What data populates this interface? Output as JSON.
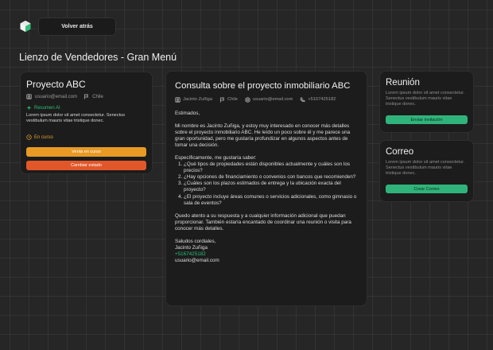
{
  "header": {
    "back_label": "Volver atrás",
    "page_title": "Lienzo de Vendedores - Gran Menú"
  },
  "project": {
    "title": "Proyecto ABC",
    "email": "usuario@email.com",
    "country": "Chile",
    "ai_label": "Resumen AI",
    "ai_summary": "Lorem ipsum dolor sit amet consectetur. Senectus vestibulum mauris vitae tristique donec.",
    "status": "En curso",
    "primary_button": "Venta en curso",
    "secondary_button": "Cambiar estado"
  },
  "email": {
    "subject": "Consulta sobre el proyecto inmobiliario ABC",
    "sender_name": "Jacinto Zuñiga",
    "country": "Chile",
    "sender_email": "usuario@email.com",
    "phone": "+5167425182",
    "greeting": "Estimados,",
    "intro": "Mi nombre es Jacinto Zuñiga, y estoy muy interesado en conocer más detalles sobre el proyecto inmobiliario ABC. He leído un poco sobre él y me parece una gran oportunidad, pero me gustaría profundizar en algunos aspectos antes de tomar una decisión.",
    "questions_intro": "Específicamente, me gustaría saber:",
    "questions": [
      "¿Qué tipos de propiedades están disponibles actualmente y cuáles son los precios?",
      "¿Hay opciones de financiamiento o convenios con bancos que recomienden?",
      "¿Cuáles son los plazos estimados de entrega y la ubicación exacta del proyecto?",
      "¿El proyecto incluye áreas comunes o servicios adicionales, como gimnasio o sala de eventos?"
    ],
    "closing": "Quedo atento a su respuesta y a cualquier información adicional que puedan proporcionar. También estaría encantado de coordinar una reunión o visita para conocer más detalles.",
    "signoff": "Saludos cordiales,",
    "signature_name": "Jacinto Zuñiga",
    "signature_phone": "+5167425182",
    "signature_email": "usuario@email.com"
  },
  "meeting": {
    "title": "Reunión",
    "description": "Lorem ipsum dolor sit amet consectetur. Senectus vestibulum mauris vitae tristique donec.",
    "button": "Enviar invitación"
  },
  "mail": {
    "title": "Correo",
    "description": "Lorem ipsum dolor sit amet consectetur. Senectus vestibulum mauris vitae tristique donec.",
    "button": "Crear Correo"
  },
  "colors": {
    "accent_green": "#2fbf77",
    "accent_orange": "#e89a25",
    "accent_red": "#e2572a",
    "status_color": "#e8a030"
  },
  "icons": {
    "logo": "cube-logo-icon",
    "email": "user-icon",
    "country": "flag-icon",
    "ai": "sparkle-icon",
    "status": "clock-icon",
    "sender_email": "at-icon",
    "phone": "phone-icon"
  }
}
